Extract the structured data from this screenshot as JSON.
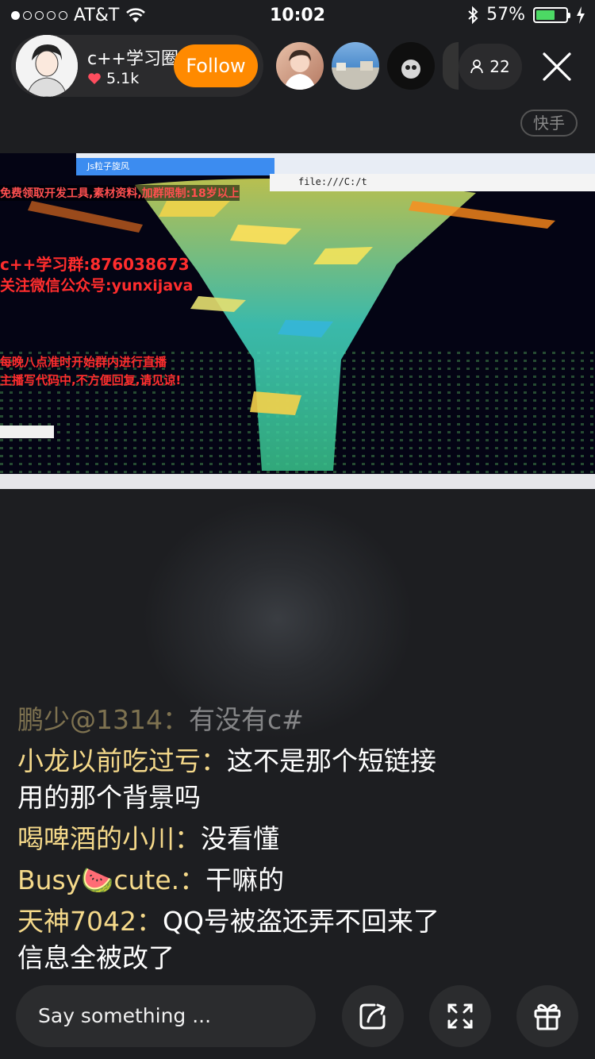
{
  "status_bar": {
    "carrier": "AT&T",
    "time": "10:02",
    "battery": "57%",
    "battery_level": 0.57
  },
  "host": {
    "name": "c++学习圈",
    "likes": "5.1k",
    "follow_label": "Follow"
  },
  "viewers_count": "22",
  "platform_badge": "快手",
  "stream": {
    "tab_title": "Js粒子旋风",
    "address": "file:///C:/t",
    "overlay_lines": [
      "免费领取开发工具,素材资料,加群限制:18岁以上",
      "c++学习群:876038673",
      "关注微信公众号:yunxijava",
      "每晚八点准时开始群内进行直播",
      "主播写代码中,不方便回复,请见谅!"
    ]
  },
  "comments": [
    {
      "user": "鹏少@1314：",
      "text": "有没有c#"
    },
    {
      "user": "小龙以前吃过亏：",
      "text": "这不是那个短链接用的那个背景吗"
    },
    {
      "user": "喝啤酒的小川：",
      "text": "没看懂"
    },
    {
      "user": "Busy🍉cute.：",
      "text": "干嘛的"
    },
    {
      "user": "天神7042：",
      "text": "QQ号被盗还弄不回来了信息全被改了"
    }
  ],
  "input": {
    "placeholder": "Say something ..."
  },
  "colors": {
    "follow": "#ff8a00",
    "username": "#f5d98a",
    "overlay_red": "#ff2d2d"
  }
}
